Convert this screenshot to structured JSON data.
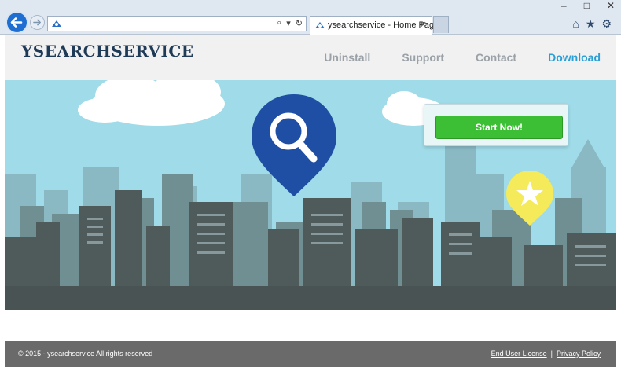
{
  "browser": {
    "address_value": "",
    "tab_title": "ysearchservice - Home Page",
    "tab_close": "✕",
    "window_controls": [
      "–",
      "□",
      "✕"
    ],
    "toolbar_icons": [
      "home-icon",
      "star-icon",
      "gear-icon"
    ],
    "address_tools": [
      "search-icon",
      "dropdown-icon",
      "refresh-icon"
    ]
  },
  "site": {
    "logo": "YSEARCHSERVICE",
    "nav": [
      "Uninstall",
      "Support",
      "Contact",
      "Download"
    ],
    "active_nav": "Download",
    "cta_label": "Start Now!",
    "footer_copy": "© 2015 - ysearchservice All rights reserved",
    "footer_links": [
      "End User License",
      "Privacy Policy"
    ],
    "footer_sep": "|"
  },
  "colors": {
    "sky": "#9fdbe8",
    "pin_blue": "#1f4fa5",
    "pin_yellow": "#f4ea5a",
    "cta_green": "#3cbf34",
    "nav_active": "#2a9fd6"
  }
}
